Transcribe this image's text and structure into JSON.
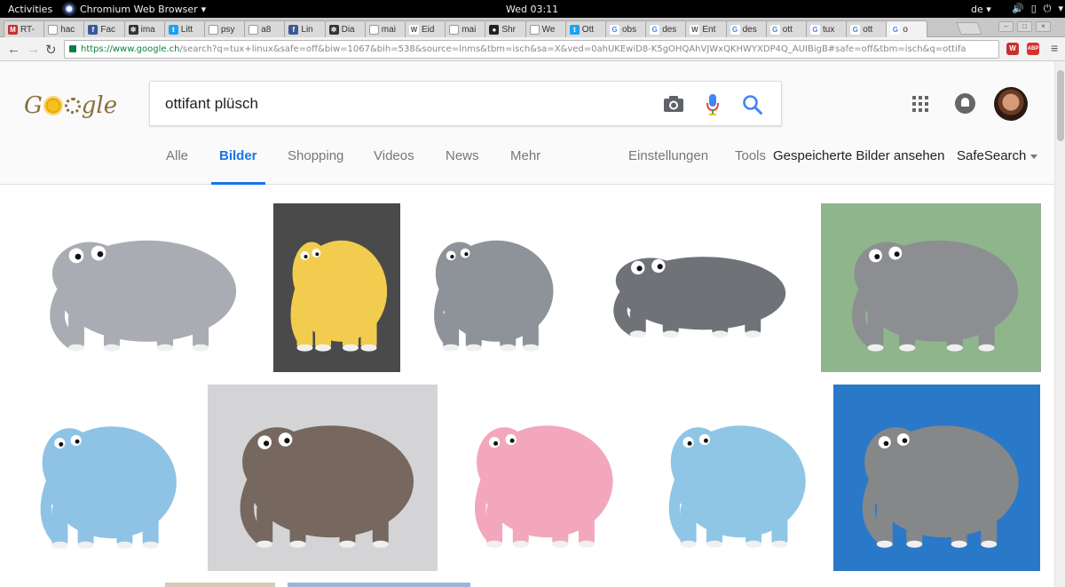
{
  "system": {
    "activities": "Activities",
    "app_name": "Chromium Web Browser",
    "clock": "Wed 03:11",
    "keyboard_layout": "de"
  },
  "browser": {
    "tabs": [
      {
        "label": "RT-",
        "icon": "mail-icon",
        "color": "#c9302c"
      },
      {
        "label": "hac",
        "icon": "page-icon",
        "color": "#888888"
      },
      {
        "label": "Fac",
        "icon": "facebook-icon",
        "color": "#3b5998"
      },
      {
        "label": "ima",
        "icon": "app-icon",
        "color": "#333333"
      },
      {
        "label": "Litt",
        "icon": "twitter-icon",
        "color": "#1da1f2"
      },
      {
        "label": "psy",
        "icon": "page-icon",
        "color": "#888888"
      },
      {
        "label": "a8",
        "icon": "page-icon",
        "color": "#888888"
      },
      {
        "label": "Lin",
        "icon": "facebook-icon",
        "color": "#3b5998"
      },
      {
        "label": "Dia",
        "icon": "app-icon",
        "color": "#333333"
      },
      {
        "label": "mai",
        "icon": "page-icon",
        "color": "#888888"
      },
      {
        "label": "Eid",
        "icon": "wikipedia-icon",
        "color": "#555555"
      },
      {
        "label": "mai",
        "icon": "page-icon",
        "color": "#888888"
      },
      {
        "label": "Shr",
        "icon": "github-icon",
        "color": "#222222"
      },
      {
        "label": "We",
        "icon": "page-icon",
        "color": "#888888"
      },
      {
        "label": "Ott",
        "icon": "twitter-icon",
        "color": "#1da1f2"
      },
      {
        "label": "obs",
        "icon": "google-icon",
        "color": "#4285f4"
      },
      {
        "label": "des",
        "icon": "google-icon",
        "color": "#4285f4"
      },
      {
        "label": "Ent",
        "icon": "wikipedia-icon",
        "color": "#555555"
      },
      {
        "label": "des",
        "icon": "google-icon",
        "color": "#4285f4"
      },
      {
        "label": "ott",
        "icon": "google-icon",
        "color": "#4285f4"
      },
      {
        "label": "tux",
        "icon": "google-icon",
        "color": "#4285f4"
      },
      {
        "label": "ott",
        "icon": "google-icon",
        "color": "#4285f4"
      },
      {
        "label": "o",
        "icon": "google-icon",
        "color": "#4285f4",
        "active": true
      }
    ],
    "url_host": "https://www.google.ch",
    "url_path": "/search?q=tux+linux&safe=off&biw=1067&bih=538&source=lnms&tbm=isch&sa=X&ved=0ahUKEwiD8-K5gOHQAhVJWxQKHWYXDP4Q_AUIBigB#safe=off&tbm=isch&q=ottifa",
    "extensions": [
      "W",
      "ABP"
    ]
  },
  "google": {
    "logo_text_left": "G",
    "logo_text_right": "gle",
    "query": "ottifant plüsch",
    "tabs": [
      {
        "label": "Alle",
        "active": false
      },
      {
        "label": "Bilder",
        "active": true
      },
      {
        "label": "Shopping",
        "active": false
      },
      {
        "label": "Videos",
        "active": false
      },
      {
        "label": "News",
        "active": false
      },
      {
        "label": "Mehr",
        "active": false
      }
    ],
    "settings_label": "Einstellungen",
    "tools_label": "Tools",
    "saved_images_label": "Gespeicherte Bilder ansehen",
    "safesearch_label": "SafeSearch",
    "accent_color": "#1a73e8"
  },
  "results": [
    {
      "name": "grey-ottifant-with-hat",
      "body": "#a9adb3",
      "bg": "#ffffff"
    },
    {
      "name": "yellow-ottifant",
      "body": "#f2cc4e",
      "bg": "#4a4a4a"
    },
    {
      "name": "man-holding-ottifant",
      "body": "#8e939a",
      "bg": "#ffffff"
    },
    {
      "name": "two-grey-ottifants",
      "body": "#6f7378",
      "bg": "#ffffff"
    },
    {
      "name": "grey-ottifant-green-bg",
      "body": "#8d8e92",
      "bg": "#8fb58c"
    },
    {
      "name": "three-ottifants",
      "body": "#8fc3e6",
      "bg": "#ffffff"
    },
    {
      "name": "brown-ottifant",
      "body": "#76685f",
      "bg": "#d4d4d6"
    },
    {
      "name": "pink-ottifant",
      "body": "#f2a7bd",
      "bg": "#ffffff"
    },
    {
      "name": "blue-ottifant",
      "body": "#8fc6e6",
      "bg": "#ffffff"
    },
    {
      "name": "grey-ottifant-blue-bg",
      "body": "#858789",
      "bg": "#2a78c8"
    },
    {
      "name": "partial-result-1",
      "body": "#a8927e",
      "bg": "#d8c8b8"
    },
    {
      "name": "partial-result-2",
      "body": "#6c8fbf",
      "bg": "#9bb6d8"
    }
  ]
}
